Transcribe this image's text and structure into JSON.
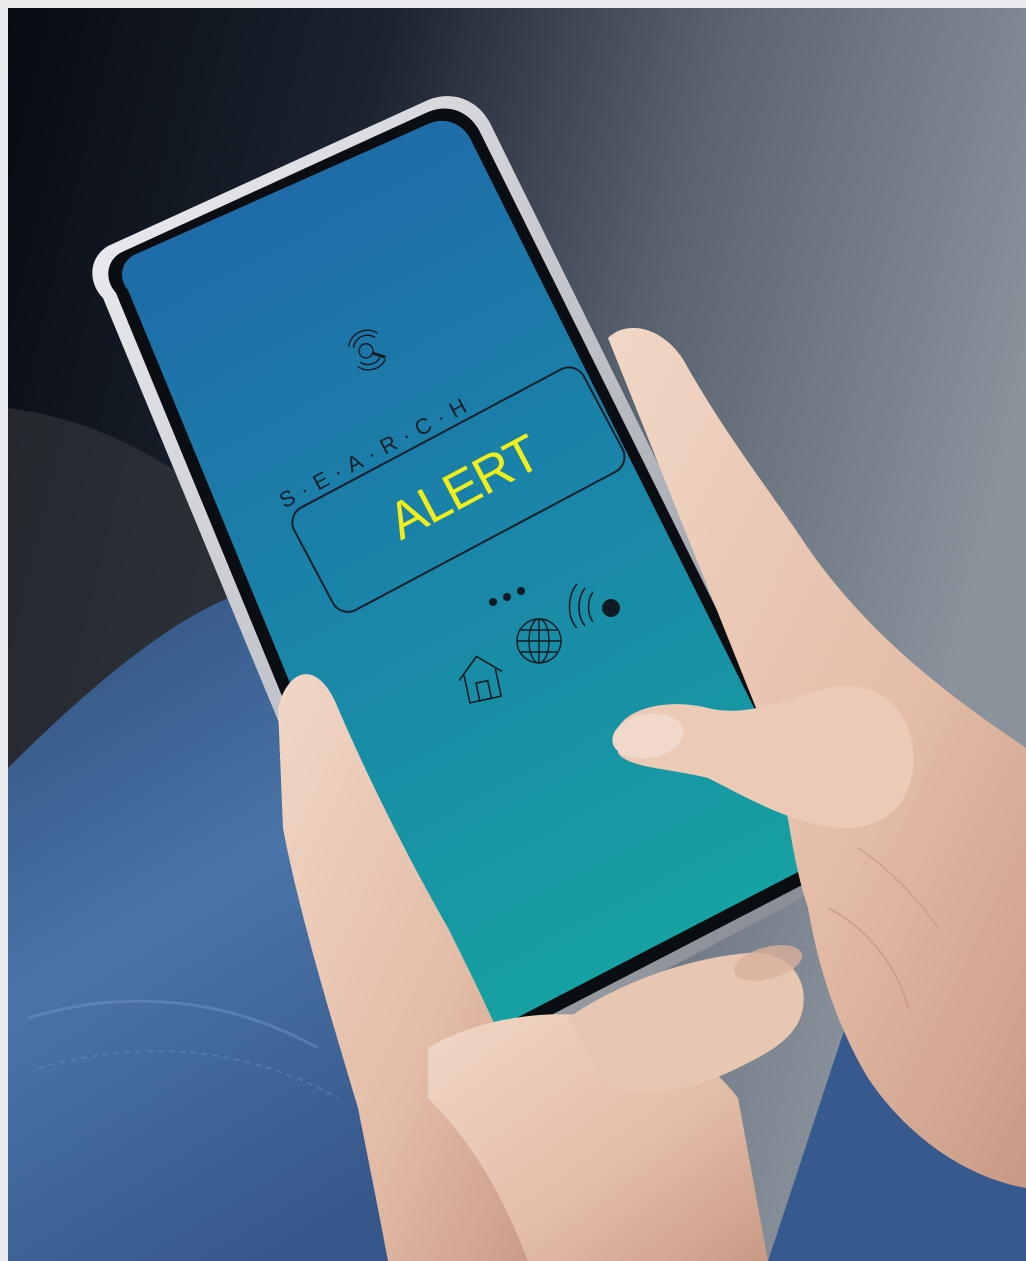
{
  "screen": {
    "search_label": "S·E·A·R·C·H",
    "alert_label": "ALERT"
  },
  "icons": [
    "search-radar-icon",
    "more-dots-icon",
    "signal-icon",
    "globe-icon",
    "home-icon"
  ],
  "colors": {
    "screen_top": "#1f6fa6",
    "screen_bottom": "#17a4a2",
    "alert_text": "#f0ee18",
    "jeans": "#3d6496",
    "background_dark": "#0c121a"
  }
}
